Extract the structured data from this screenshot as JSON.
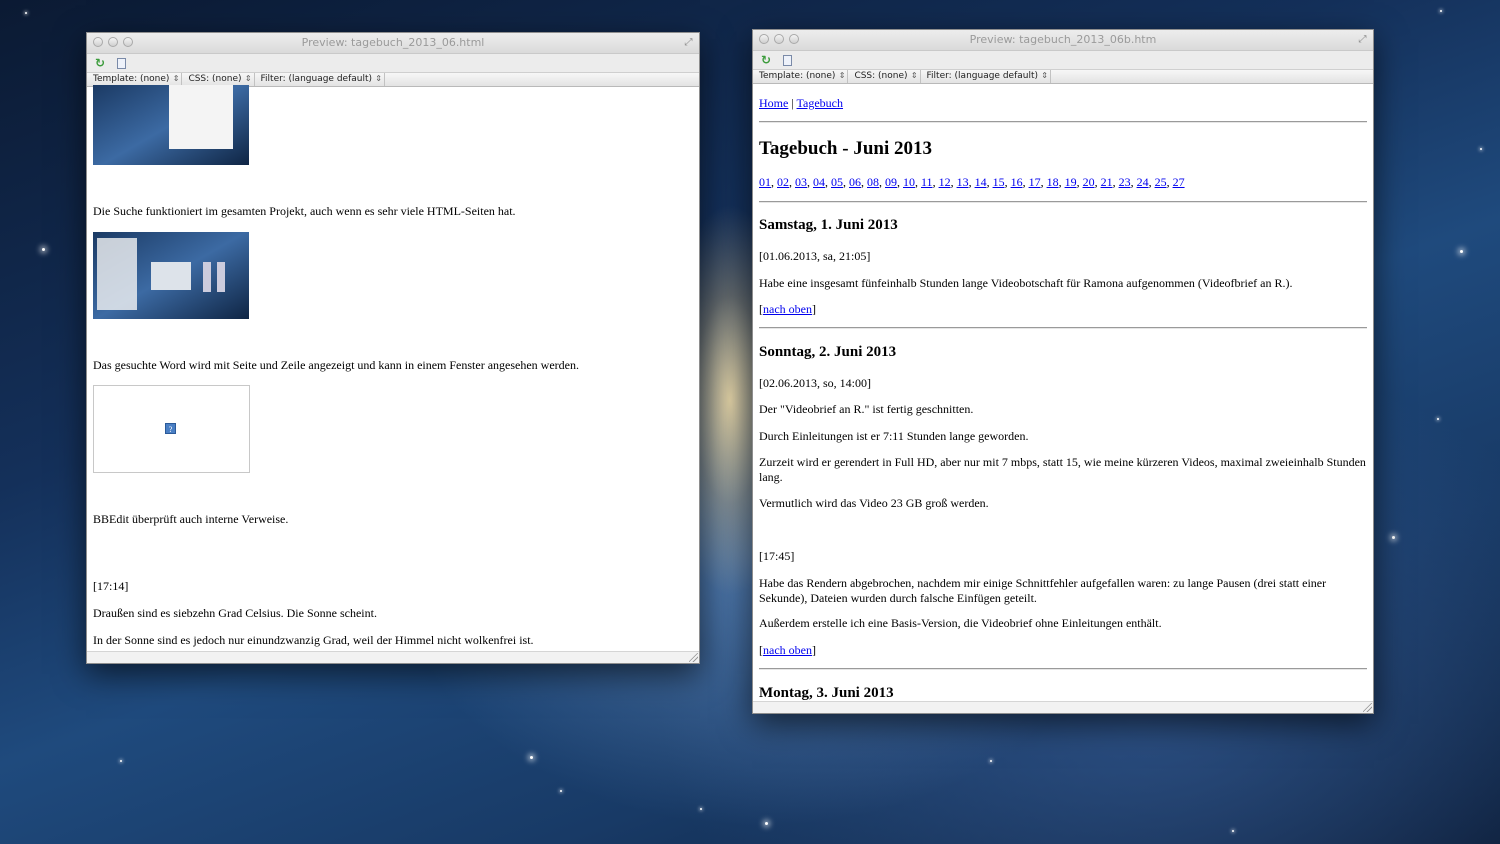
{
  "left_window": {
    "title": "Preview: tagebuch_2013_06.html",
    "options": [
      "Template: (none)",
      "CSS: (none)",
      "Filter: (language default)"
    ],
    "paragraphs": [
      "Die Suche funktioniert im gesamten Projekt, auch wenn es sehr viele HTML-Seiten hat.",
      "Das gesuchte Word wird mit Seite und Zeile angezeigt und kann in einem Fenster angesehen werden.",
      "BBEdit überprüft auch interne Verweise.",
      "[17:14]",
      "Draußen sind es siebzehn Grad Celsius. Die Sonne scheint.",
      "In der Sonne sind es jedoch nur einundzwanzig Grad, weil der Himmel nicht wolkenfrei ist."
    ]
  },
  "right_window": {
    "title": "Preview: tagebuch_2013_06b.htm",
    "options": [
      "Template: (none)",
      "CSS: (none)",
      "Filter: (language default)"
    ],
    "nav": {
      "home": "Home",
      "sep": "|",
      "diary": "Tagebuch"
    },
    "heading": "Tagebuch - Juni 2013",
    "days": [
      "01",
      "02",
      "03",
      "04",
      "05",
      "06",
      "08",
      "09",
      "10",
      "11",
      "12",
      "13",
      "14",
      "15",
      "16",
      "17",
      "18",
      "19",
      "20",
      "21",
      "23",
      "24",
      "25",
      "27"
    ],
    "entry1": {
      "title": "Samstag, 1. Juni 2013",
      "stamp": "[01.06.2013, sa, 21:05]",
      "text": "Habe eine insgesamt fünfeinhalb Stunden lange Videobotschaft für Ramona aufgenommen (Videofbrief an R.).",
      "top_link": "nach oben"
    },
    "entry2": {
      "title": "Sonntag, 2. Juni 2013",
      "stamp": "[02.06.2013, so, 14:00]",
      "p1": "Der \"Videobrief an R.\" ist fertig geschnitten.",
      "p2": "Durch Einleitungen ist er 7:11 Stunden lange geworden.",
      "p3": "Zurzeit wird er gerendert in Full HD, aber nur mit 7 mbps, statt 15, wie meine kürzeren Videos, maximal zweieinhalb Stunden lang.",
      "p4": "Vermutlich wird das Video 23 GB groß werden.",
      "stamp2": "[17:45]",
      "p5": "Habe das Rendern abgebrochen, nachdem mir einige Schnittfehler aufgefallen waren: zu lange Pausen (drei statt einer Sekunde), Dateien wurden durch falsche Einfügen geteilt.",
      "p6": "Außerdem erstelle ich eine Basis-Version, die Videobrief ohne Einleitungen enthält.",
      "top_link": "nach oben"
    },
    "entry3": {
      "title": "Montag, 3. Juni 2013"
    }
  }
}
